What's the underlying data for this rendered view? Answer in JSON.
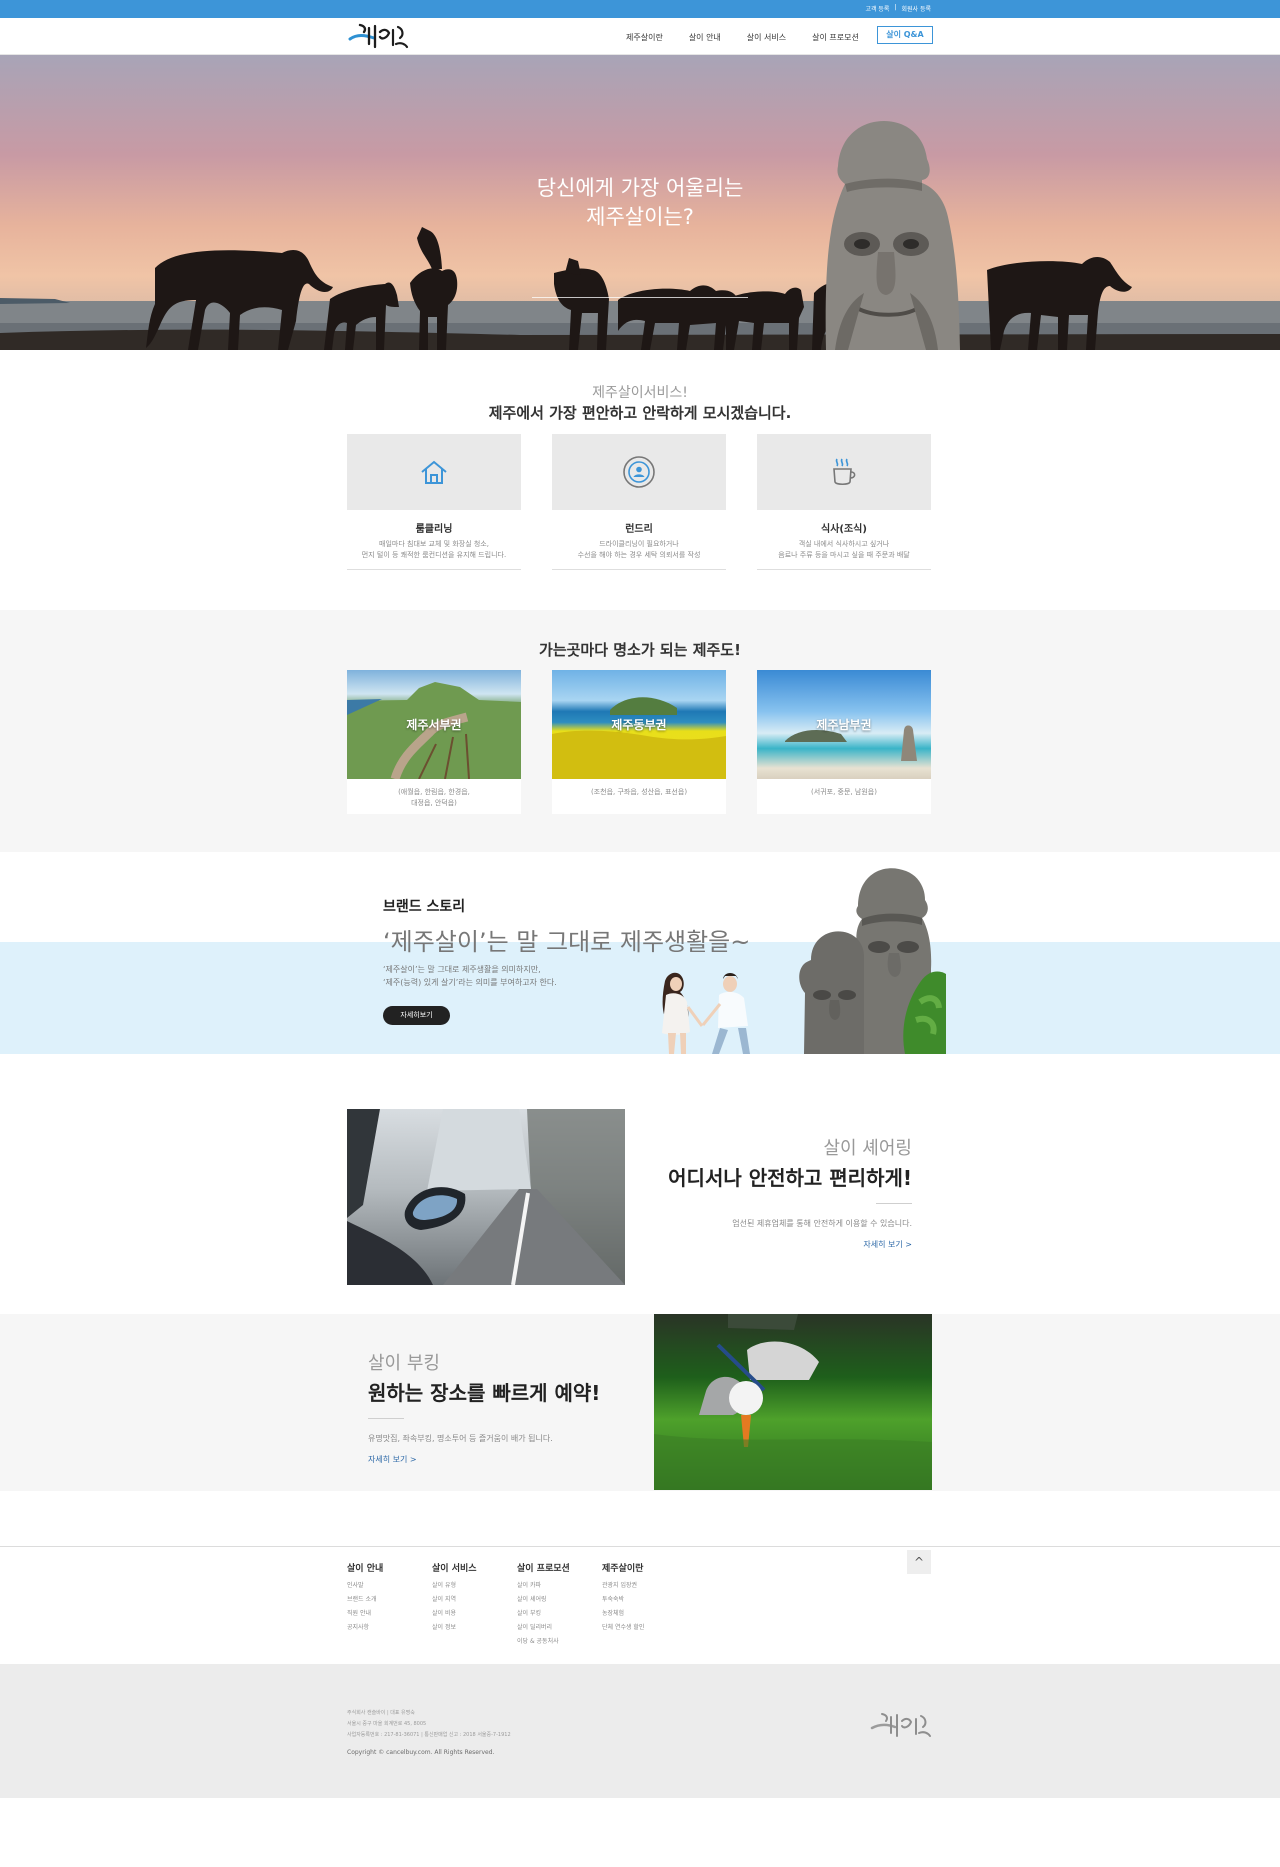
{
  "topbar": {
    "links": [
      "고객 등록",
      "회원사 등록"
    ]
  },
  "header": {
    "nav": [
      "제주살이란",
      "살이 안내",
      "살이 서비스",
      "살이 프로모션"
    ],
    "qa_button": "살이 Q&A"
  },
  "hero": {
    "title_line1": "당신에게 가장 어울리는",
    "title_line2": "제주살이는?"
  },
  "services": {
    "subtitle": "제주살이서비스!",
    "title": "제주에서 가장 편안하고 안락하게 모시겠습니다.",
    "items": [
      {
        "icon": "house-icon",
        "name": "룸클리닝",
        "desc1": "매일마다 침대보 교체 및 화장실 청소,",
        "desc2": "먼지 털이 등 쾌적한 룸컨디션을 유지해 드립니다."
      },
      {
        "icon": "person-badge-icon",
        "name": "런드리",
        "desc1": "드라이클리닝이 필요하거나",
        "desc2": "수선을 해야 하는 경우 세탁 의뢰서를 작성"
      },
      {
        "icon": "coffee-cup-icon",
        "name": "식사(조식)",
        "desc1": "객실 내에서 식사하시고 싶거나",
        "desc2": "음료나 주류 등을 마시고 싶을 때 주문과 배달"
      }
    ]
  },
  "places": {
    "title": "가는곳마다 명소가 되는 제주도!",
    "items": [
      {
        "name": "제주서부권",
        "sub1": "(애월읍, 한림읍, 한경읍,",
        "sub2": "대정읍, 안덕읍)"
      },
      {
        "name": "제주동부권",
        "sub1": "(조천읍, 구좌읍, 성산읍, 표선읍)",
        "sub2": ""
      },
      {
        "name": "제주남부권",
        "sub1": "(서귀포, 중문, 남원읍)",
        "sub2": ""
      }
    ]
  },
  "brand": {
    "heading": "브랜드 스토리",
    "slogan": "‘제주살이’는 말 그대로 제주생활을~",
    "desc1": "‘제주살이’는 말 그대로 제주생활을 의미하지만,",
    "desc2": "‘제주(능력) 있게 살기’라는 의미를 부여하고자 한다.",
    "button": "자세히보기"
  },
  "sharing": {
    "subtitle": "살이 셰어링",
    "title": "어디서나 안전하고 편리하게!",
    "desc": "엄선된 제휴업체를 통해 안전하게 이용할 수 있습니다.",
    "more": "자세히 보기 >"
  },
  "booking": {
    "subtitle": "살이 부킹",
    "title": "원하는 장소를 빠르게 예약!",
    "desc": "유명맛집, 좌속부킹, 명소투어 등 즐거움이 배가 됩니다.",
    "more": "자세히 보기 >"
  },
  "footer_nav": {
    "columns": [
      {
        "title": "살이 안내",
        "items": [
          "인사말",
          "브랜드 소개",
          "직원 안내",
          "공지사항"
        ]
      },
      {
        "title": "살이 서비스",
        "items": [
          "살이 유형",
          "살이 지역",
          "살이 비용",
          "살이 정보"
        ]
      },
      {
        "title": "살이 프로모션",
        "items": [
          "살이 카파",
          "살이 셰어링",
          "살이 부킹",
          "살이 딜리버리",
          "이당 & 공동처사"
        ]
      },
      {
        "title": "제주살이란",
        "items": [
          "관광지 입장권",
          "투숙숙박",
          "농장체험",
          "단체 연수생 할인"
        ]
      }
    ],
    "top_button": "^"
  },
  "footer": {
    "info1": "주식회사 캔슬바이 | 대표 유명숙",
    "info2": "서울시 중구 마을 회계번로 45, 8005",
    "info3": "사업자등록번호 : 217-81-36071 | 통신판매업 신고 : 2018 서울중-7-1912",
    "copyright": "Copyright © cancelbuy.com. All Rights Reserved."
  }
}
